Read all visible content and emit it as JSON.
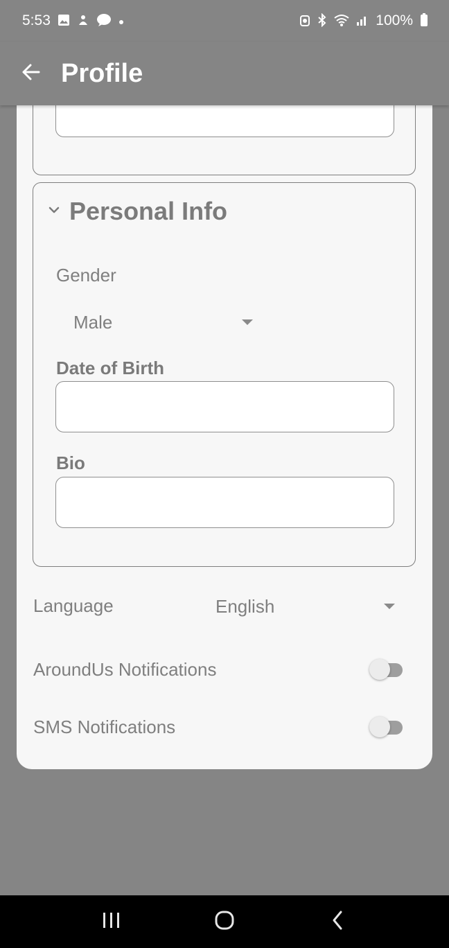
{
  "status_bar": {
    "time": "5:53",
    "battery": "100%",
    "icons_left": [
      "gallery-icon",
      "app-icon",
      "chat-icon",
      "dot-icon"
    ],
    "icons_right": [
      "alarm-icon",
      "bluetooth-icon",
      "wifi-icon",
      "signal-icon",
      "battery-icon"
    ]
  },
  "app_bar": {
    "title": "Profile",
    "back_icon": "arrow-left-icon"
  },
  "personal_info": {
    "title": "Personal Info",
    "gender_label": "Gender",
    "gender_value": "Male",
    "dob_label": "Date of Birth",
    "dob_value": "",
    "bio_label": "Bio",
    "bio_value": ""
  },
  "settings": {
    "language_label": "Language",
    "language_value": "English",
    "aroundus_label": "AroundUs Notifications",
    "aroundus_enabled": false,
    "sms_label": "SMS Notifications",
    "sms_enabled": false
  },
  "colors": {
    "background": "#858585",
    "sheet": "#f7f7f7",
    "text_muted": "#7f7f7f",
    "nav_bar": "#000000"
  }
}
